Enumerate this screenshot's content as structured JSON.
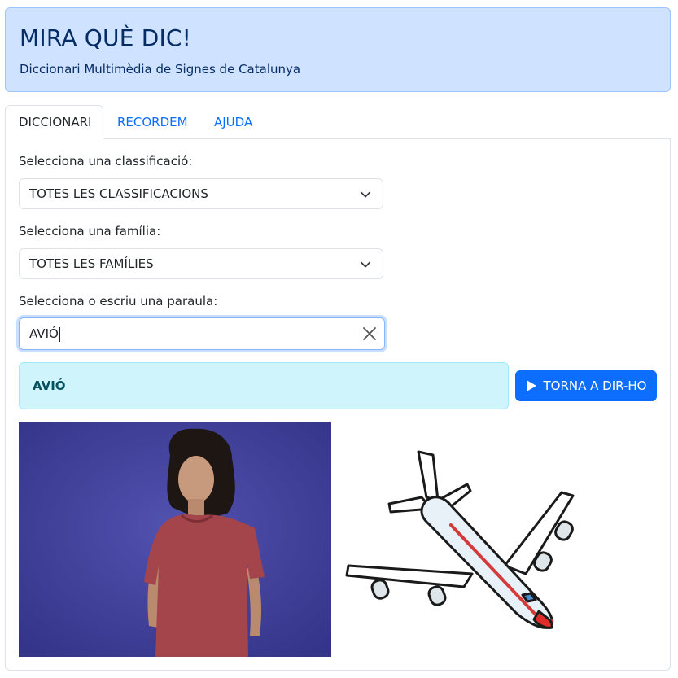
{
  "header": {
    "title": "MIRA QUÈ DIC!",
    "subtitle": "Diccionari Multimèdia de Signes de Catalunya"
  },
  "tabs": [
    {
      "label": "DICCIONARI",
      "active": true
    },
    {
      "label": "RECORDEM",
      "active": false
    },
    {
      "label": "AJUDA",
      "active": false
    }
  ],
  "form": {
    "classification_label": "Selecciona una classificació:",
    "classification_value": "TOTES LES CLASSIFICACIONS",
    "family_label": "Selecciona una família:",
    "family_value": "TOTES LES FAMÍLIES",
    "word_label": "Selecciona o escriu una paraula:",
    "word_value": "AVIÓ"
  },
  "result": {
    "word": "AVIÓ",
    "replay_label": "TORNA A DIR-HO"
  },
  "icons": {
    "select_chevron": "chevron-down-icon",
    "clear": "close-icon",
    "replay": "play-icon",
    "pictogram": "airplane-icon"
  },
  "colors": {
    "header_bg": "#cfe2ff",
    "header_text": "#052c65",
    "link": "#0d6efd",
    "alert_bg": "#cff4fc",
    "alert_text": "#055160",
    "button_bg": "#0d6efd",
    "video_bg": "#3d3d9a"
  }
}
